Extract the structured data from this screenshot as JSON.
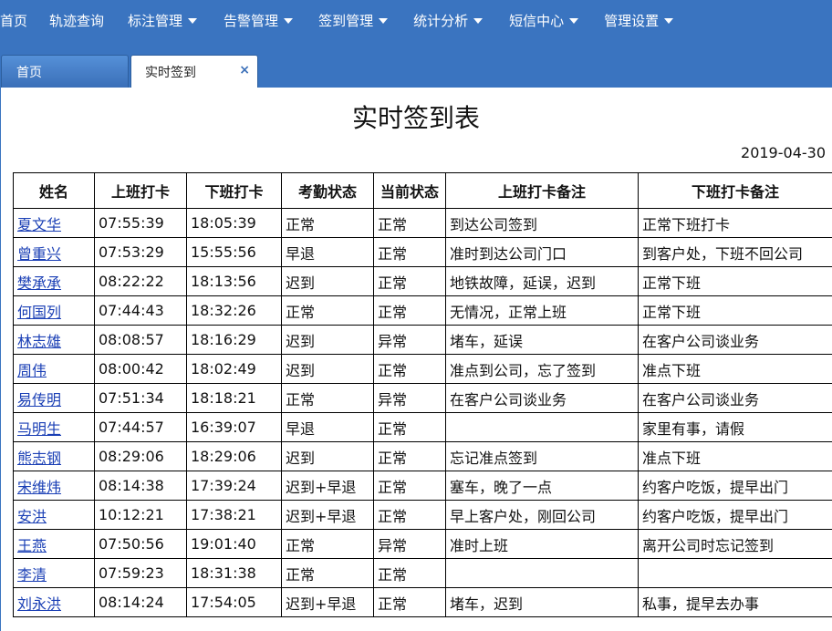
{
  "nav": [
    {
      "label": "首页",
      "dropdown": false
    },
    {
      "label": "轨迹查询",
      "dropdown": false
    },
    {
      "label": "标注管理",
      "dropdown": true
    },
    {
      "label": "告警管理",
      "dropdown": true
    },
    {
      "label": "签到管理",
      "dropdown": true
    },
    {
      "label": "统计分析",
      "dropdown": true
    },
    {
      "label": "短信中心",
      "dropdown": true
    },
    {
      "label": "管理设置",
      "dropdown": true
    }
  ],
  "tabs": {
    "home": "首页",
    "active": "实时签到",
    "close": "×"
  },
  "report": {
    "title": "实时签到表",
    "date": "2019-04-30"
  },
  "table": {
    "headers": [
      "姓名",
      "上班打卡",
      "下班打卡",
      "考勤状态",
      "当前状态",
      "上班打卡备注",
      "下班打卡备注"
    ],
    "rows": [
      [
        "夏文华",
        "07:55:39",
        "18:05:39",
        "正常",
        "正常",
        "到达公司签到",
        "正常下班打卡"
      ],
      [
        "曾重兴",
        "07:53:29",
        "15:55:56",
        "早退",
        "正常",
        "准时到达公司门口",
        "到客户处，下班不回公司"
      ],
      [
        "樊承承",
        "08:22:22",
        "18:13:56",
        "迟到",
        "正常",
        "地铁故障，延误，迟到",
        "正常下班"
      ],
      [
        "何国列",
        "07:44:43",
        "18:32:26",
        "正常",
        "正常",
        "无情况，正常上班",
        "正常下班"
      ],
      [
        "林志雄",
        "08:08:57",
        "18:16:29",
        "迟到",
        "异常",
        "堵车，延误",
        "在客户公司谈业务"
      ],
      [
        "周伟",
        "08:00:42",
        "18:02:49",
        "迟到",
        "正常",
        "准点到公司，忘了签到",
        "准点下班"
      ],
      [
        "易传明",
        "07:51:34",
        "18:18:21",
        "正常",
        "异常",
        "在客户公司谈业务",
        "在客户公司谈业务"
      ],
      [
        "马明生",
        "07:44:57",
        "16:39:07",
        "早退",
        "正常",
        "",
        "家里有事，请假"
      ],
      [
        "熊志钢",
        "08:29:06",
        "18:29:06",
        "迟到",
        "正常",
        "忘记准点签到",
        "准点下班"
      ],
      [
        "宋维炜",
        "08:14:38",
        "17:39:24",
        "迟到+早退",
        "正常",
        "塞车，晚了一点",
        "约客户吃饭，提早出门"
      ],
      [
        "安洪",
        "10:12:21",
        "17:38:21",
        "迟到+早退",
        "正常",
        "早上客户处，刚回公司",
        "约客户吃饭，提早出门"
      ],
      [
        "王燕",
        "07:50:56",
        "19:01:40",
        "正常",
        "异常",
        "准时上班",
        "离开公司时忘记签到"
      ],
      [
        "李清",
        "07:59:23",
        "18:31:38",
        "正常",
        "正常",
        "",
        ""
      ],
      [
        "刘永洪",
        "08:14:24",
        "17:54:05",
        "迟到+早退",
        "正常",
        "堵车，迟到",
        "私事，提早去办事"
      ]
    ]
  }
}
